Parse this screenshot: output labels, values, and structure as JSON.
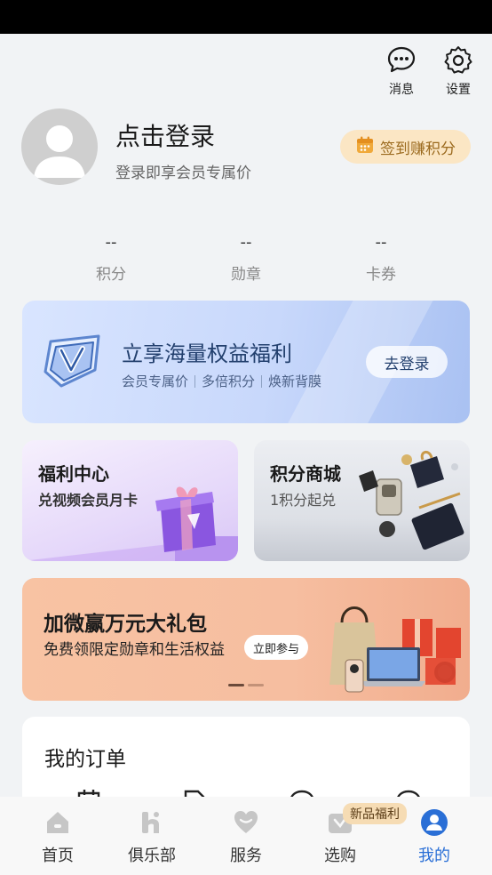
{
  "top_actions": {
    "messages_label": "消息",
    "settings_label": "设置"
  },
  "profile": {
    "login_title": "点击登录",
    "login_subtitle": "登录即享会员专属价",
    "checkin_label": "签到赚积分"
  },
  "stats": [
    {
      "value": "--",
      "label": "积分"
    },
    {
      "value": "--",
      "label": "勋章"
    },
    {
      "value": "--",
      "label": "卡券"
    }
  ],
  "vip_card": {
    "title": "立享海量权益福利",
    "tags": [
      "会员专属价",
      "多倍积分",
      "焕新背膜"
    ],
    "login_button": "去登录"
  },
  "promos": {
    "welfare": {
      "title": "福利中心",
      "subtitle": "兑视频会员月卡"
    },
    "points_mall": {
      "title": "积分商城",
      "subtitle": "1积分起兑"
    }
  },
  "banner": {
    "title": "加微赢万元大礼包",
    "subtitle": "免费领限定勋章和生活权益",
    "join_button": "立即参与"
  },
  "orders": {
    "title": "我的订单"
  },
  "tabbar": {
    "home": "首页",
    "club": "俱乐部",
    "service": "服务",
    "shop": "选购",
    "shop_badge": "新品福利",
    "mine": "我的"
  },
  "colors": {
    "accent": "#2a6fd6",
    "checkin_bg": "#fbe6c4",
    "banner_bg": "#f6bea0"
  }
}
